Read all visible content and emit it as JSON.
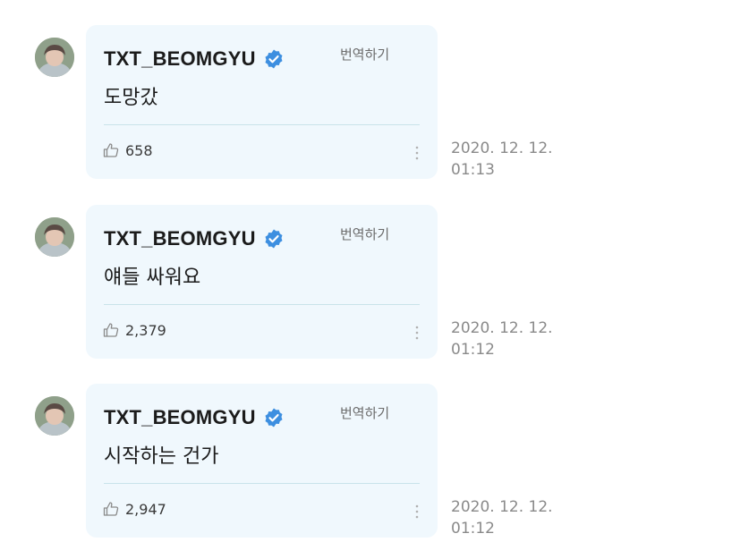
{
  "posts": [
    {
      "username": "TXT_BEOMGYU",
      "verified": true,
      "translate_label": "번역하기",
      "message": "도망갔",
      "likes": "658",
      "timestamp": "2020. 12. 12.\n01:13"
    },
    {
      "username": "TXT_BEOMGYU",
      "verified": true,
      "translate_label": "번역하기",
      "message": "얘들 싸워요",
      "likes": "2,379",
      "timestamp": "2020. 12. 12.\n01:12"
    },
    {
      "username": "TXT_BEOMGYU",
      "verified": true,
      "translate_label": "번역하기",
      "message": "시작하는 건가",
      "likes": "2,947",
      "timestamp": "2020. 12. 12.\n01:12"
    }
  ],
  "icons": {
    "verified": "verified-badge-icon",
    "like": "thumbs-up-icon",
    "more": "more-vertical-icon"
  },
  "colors": {
    "bubble_bg": "#f0f8fd",
    "verified_blue": "#3d8fe0",
    "divider": "#c9e3ea",
    "timestamp": "#8a8a8a"
  }
}
